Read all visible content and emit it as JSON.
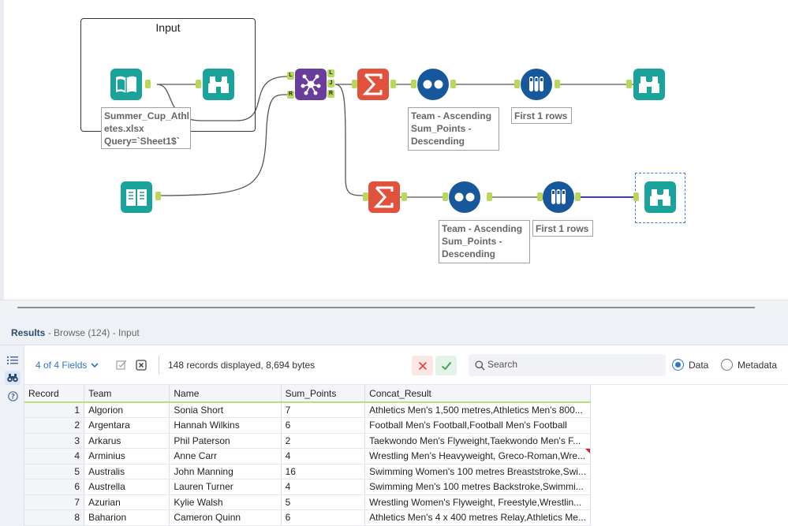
{
  "canvas": {
    "container": {
      "title": "Input"
    },
    "annotations": {
      "input_file": "Summer_Cup_Athl\netes.xlsx\nQuery=`Sheet1$`",
      "sort_top": "Team - Ascending\nSum_Points -\nDescending",
      "sample_top": "First 1 rows",
      "sort_bottom": "Team - Ascending\nSum_Points -\nDescending",
      "sample_bottom": "First 1 rows"
    },
    "anchors": {
      "left": "L",
      "right": "R",
      "join_out": "J"
    },
    "colors": {
      "input_tool": "#1aa39a",
      "browse_tool": "#1aa39a",
      "join_tool": "#6a3d9a",
      "summarize_tool": "#e1523d",
      "sort_tool": "#17589c",
      "sample_tool": "#17589c",
      "anchor": "#b9d85b",
      "connector": "#555555",
      "selected_connector": "#3a3ad0"
    }
  },
  "results": {
    "title_bold": "Results",
    "title_rest": " - Browse (124) - Input",
    "fields_label": "4 of 4 Fields",
    "records_info": "148 records displayed, 8,694 bytes",
    "search_placeholder": "Search",
    "view_options": [
      {
        "label": "Data",
        "selected": true
      },
      {
        "label": "Metadata",
        "selected": false
      }
    ],
    "columns": [
      "Record",
      "Team",
      "Name",
      "Sum_Points",
      "Concat_Result"
    ],
    "rows": [
      [
        "1",
        "Algorion",
        "Sonia Short",
        "7",
        "Athletics Men's 1,500 metres,Athletics Men's 800..."
      ],
      [
        "2",
        "Argentara",
        "Hannah Wilkins",
        "6",
        "Football Men's Football,Football Men's Football"
      ],
      [
        "3",
        "Arkarus",
        "Phil Paterson",
        "2",
        "Taekwondo Men's Flyweight,Taekwondo Men's F..."
      ],
      [
        "4",
        "Arminius",
        "Anne Carr",
        "4",
        "Wrestling Men's Heavyweight, Greco-Roman,Wre..."
      ],
      [
        "5",
        "Australis",
        "John Manning",
        "16",
        "Swimming Women's 100 metres Breaststroke,Swi..."
      ],
      [
        "6",
        "Austrella",
        "Lauren Turner",
        "4",
        "Swimming Men's 100 metres Backstroke,Swimmi..."
      ],
      [
        "7",
        "Azurian",
        "Kylie Walsh",
        "5",
        "Wrestling Women's Flyweight, Freestyle,Wrestlin..."
      ],
      [
        "8",
        "Baharion",
        "Cameron Quinn",
        "6",
        "Athletics Men's 4 x 400 metres Relay,Athletics Me..."
      ]
    ]
  }
}
